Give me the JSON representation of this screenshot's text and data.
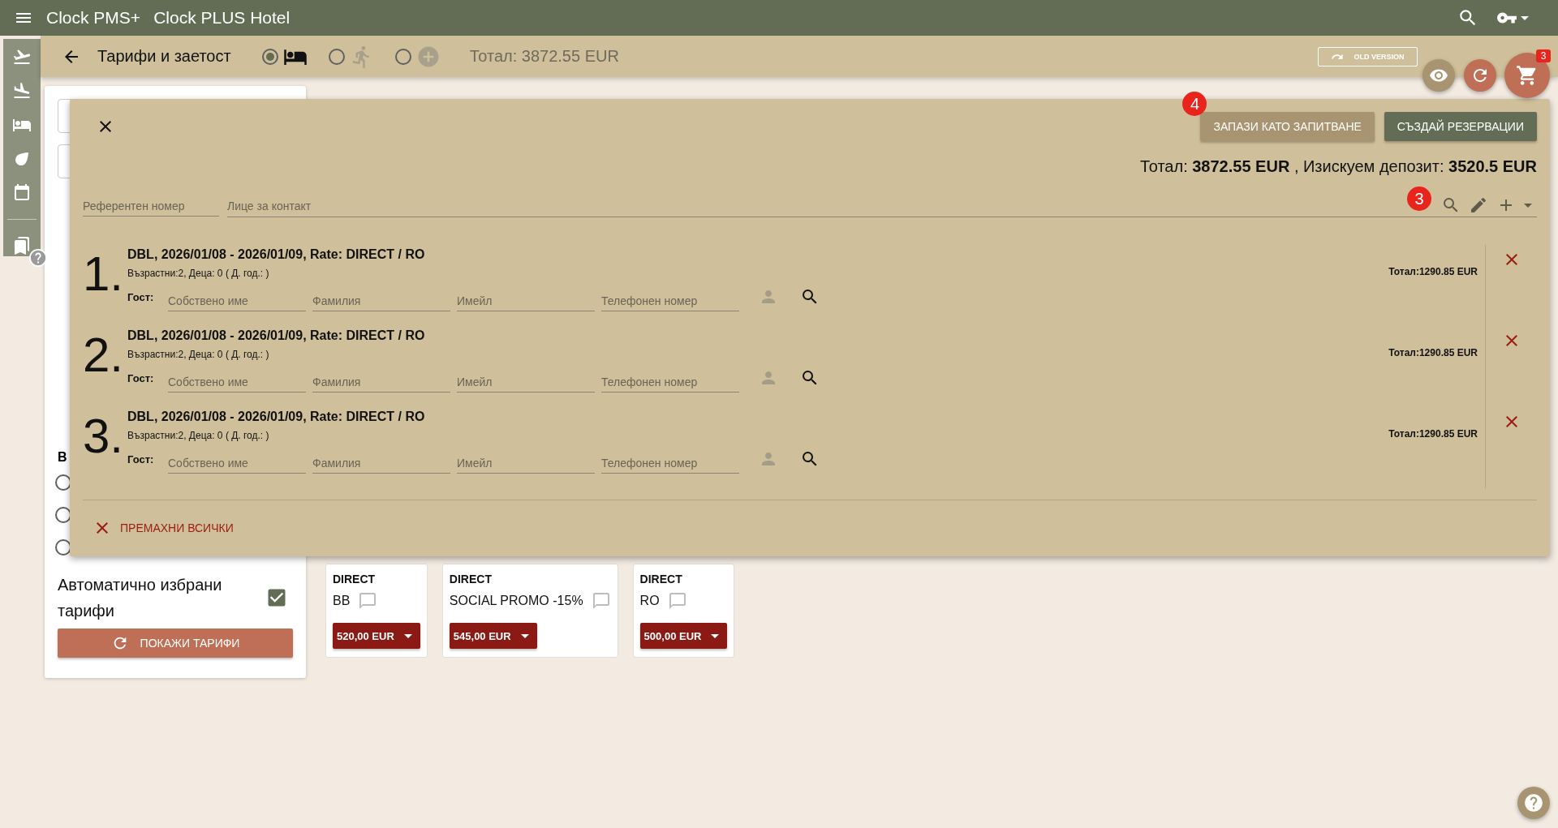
{
  "app_bar": {
    "brand": "Clock PMS+",
    "hotel": "Clock PLUS Hotel"
  },
  "page_header": {
    "title": "Тарифи и заетост",
    "modes": [
      {
        "kind": "room",
        "selected": true
      },
      {
        "kind": "walk_in",
        "selected": false
      },
      {
        "kind": "extra",
        "selected": false
      }
    ],
    "total": "Тотал: 3872.55 EUR",
    "old_version_button": "OLD VERSION"
  },
  "cart_fab": {
    "badge": "3"
  },
  "left_panel": {
    "heading": "В",
    "radios": [
      {
        "selected": false
      },
      {
        "selected": false
      },
      {
        "selected": false
      }
    ],
    "auto_rates": {
      "label": "Автоматично избрани тарифи",
      "checked": true
    },
    "show_rates_button": "ПОКАЖИ ТАРИФИ"
  },
  "rate_cards": [
    {
      "channel": "DIRECT",
      "name": "BB",
      "price": "520,00 EUR"
    },
    {
      "channel": "DIRECT",
      "name": "SOCIAL PROMO -15%",
      "price": "545,00 EUR"
    },
    {
      "channel": "DIRECT",
      "name": "RO",
      "price": "500,00 EUR"
    }
  ],
  "cart_panel": {
    "save_step": "4",
    "save_button": "ЗАПАЗИ КАТО ЗАПИТВАНЕ",
    "create_button": "СЪЗДАЙ РЕЗЕРВАЦИИ",
    "totals": "Тотал: **3872.55 EUR** , Изискуем депозит: **3520.5 EUR**",
    "reference_field": {
      "placeholder": "Референтен номер"
    },
    "contact_field": {
      "placeholder": "Лице за контакт"
    },
    "tools_step": "3",
    "reservations": [
      {
        "number": "1.",
        "title": "DBL, 2026/01/08 - 2026/01/09, Rate: DIRECT / RO",
        "occupancy": "Възрастни:2, Деца: 0 ( Д. год.: )",
        "guest_label": "Гост:",
        "guest_fields": [
          {
            "placeholder": "Собствено име"
          },
          {
            "placeholder": "Фамилия"
          },
          {
            "placeholder": "Имейл"
          },
          {
            "placeholder": "Телефонен номер"
          }
        ],
        "total": "Тотал:1290.85 EUR"
      },
      {
        "number": "2.",
        "title": "DBL, 2026/01/08 - 2026/01/09, Rate: DIRECT / RO",
        "occupancy": "Възрастни:2, Деца: 0 ( Д. год.: )",
        "guest_label": "Гост:",
        "guest_fields": [
          {
            "placeholder": "Собствено име"
          },
          {
            "placeholder": "Фамилия"
          },
          {
            "placeholder": "Имейл"
          },
          {
            "placeholder": "Телефонен номер"
          }
        ],
        "total": "Тотал:1290.85 EUR"
      },
      {
        "number": "3.",
        "title": "DBL, 2026/01/08 - 2026/01/09, Rate: DIRECT / RO",
        "occupancy": "Възрастни:2, Деца: 0 ( Д. год.: )",
        "guest_label": "Гост:",
        "guest_fields": [
          {
            "placeholder": "Собствено име"
          },
          {
            "placeholder": "Фамилия"
          },
          {
            "placeholder": "Имейл"
          },
          {
            "placeholder": "Телефонен номер"
          }
        ],
        "total": "Тотал:1290.85 EUR"
      }
    ],
    "remove_all_button": "ПРЕМАХНИ ВСИЧКИ"
  }
}
